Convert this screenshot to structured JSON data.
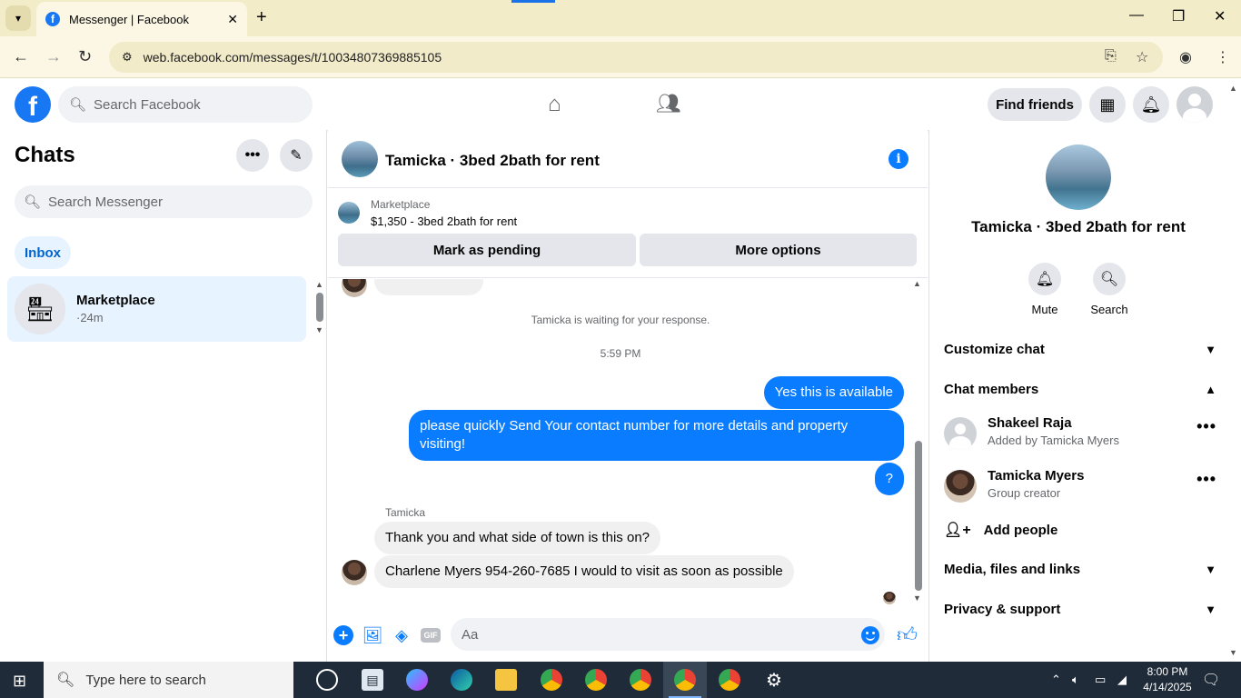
{
  "browser": {
    "tab_title": "Messenger | Facebook",
    "url": "web.facebook.com/messages/t/10034807369885105"
  },
  "fb_header": {
    "search_placeholder": "Search Facebook",
    "find_friends": "Find friends"
  },
  "left": {
    "title": "Chats",
    "search_placeholder": "Search Messenger",
    "inbox": "Inbox",
    "conversation": {
      "name": "Marketplace",
      "time": "·24m"
    }
  },
  "center": {
    "header_title": "Tamicka · 3bed 2bath for rent",
    "marketplace_label": "Marketplace",
    "listing": "$1,350 - 3bed 2bath for rent",
    "mark_pending": "Mark as pending",
    "more_options": "More options",
    "waiting": "Tamicka is waiting for your response.",
    "time": "5:59 PM",
    "outgoing": [
      "Yes this is available",
      "please quickly Send Your contact number for more details and property visiting!",
      "?"
    ],
    "sender": "Tamicka",
    "incoming": [
      "Thank you and what side of town is this on?",
      "Charlene Myers 954-260-7685 I would to visit as soon as possible"
    ],
    "composer_placeholder": "Aa",
    "gif_label": "GIF"
  },
  "right": {
    "title": "Tamicka · 3bed 2bath for rent",
    "mute": "Mute",
    "search": "Search",
    "customize_chat": "Customize chat",
    "chat_members": "Chat members",
    "members": [
      {
        "name": "Shakeel Raja",
        "sub": "Added by Tamicka Myers"
      },
      {
        "name": "Tamicka Myers",
        "sub": "Group creator"
      }
    ],
    "add_people": "Add people",
    "media": "Media, files and links",
    "privacy": "Privacy & support"
  },
  "taskbar": {
    "search_placeholder": "Type here to search",
    "time": "8:00 PM",
    "date": "4/14/2025"
  }
}
